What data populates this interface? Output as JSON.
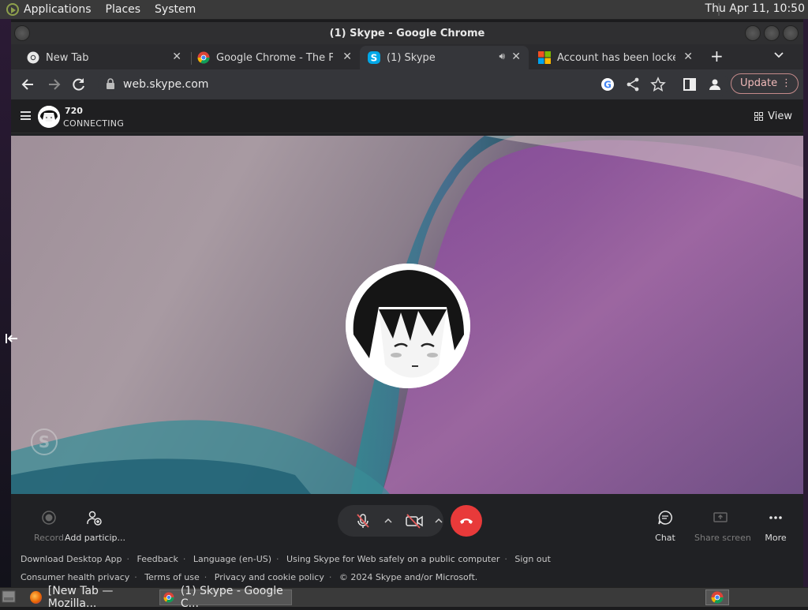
{
  "top_panel": {
    "menu": [
      "Applications",
      "Places",
      "System"
    ],
    "clock": "Thu Apr 11, 10:50"
  },
  "window": {
    "title": "(1) Skype - Google Chrome"
  },
  "tabs": [
    {
      "title": "New Tab",
      "favicon": "chrome-icon"
    },
    {
      "title": "Google Chrome - The Fas",
      "favicon": "chrome-icon"
    },
    {
      "title": "(1) Skype",
      "favicon": "skype-icon",
      "active": true,
      "audio": true
    },
    {
      "title": "Account has been locked -",
      "favicon": "microsoft-icon"
    }
  ],
  "toolbar": {
    "url": "web.skype.com",
    "update_label": "Update"
  },
  "skype_header": {
    "caller_name": "720",
    "status": "CONNECTING",
    "view_label": "View"
  },
  "controls": {
    "record": "Record",
    "add_participants": "Add particip...",
    "chat": "Chat",
    "share_screen": "Share screen",
    "more": "More"
  },
  "footer": {
    "row1": [
      "Download Desktop App",
      "Feedback",
      "Language (en-US)",
      "Using Skype for Web safely on a public computer",
      "Sign out"
    ],
    "row2": [
      "Consumer health privacy",
      "Terms of use",
      "Privacy and cookie policy",
      "© 2024 Skype and/or Microsoft."
    ]
  },
  "taskbar": {
    "items": [
      {
        "title": "[New Tab — Mozilla...",
        "icon": "firefox-icon"
      },
      {
        "title": "(1) Skype - Google C...",
        "icon": "chrome-icon",
        "active": true
      }
    ]
  },
  "colors": {
    "hangup": "#e83a3a",
    "update_border": "#c48a8a",
    "stage_purple": "#7a4c8c"
  }
}
